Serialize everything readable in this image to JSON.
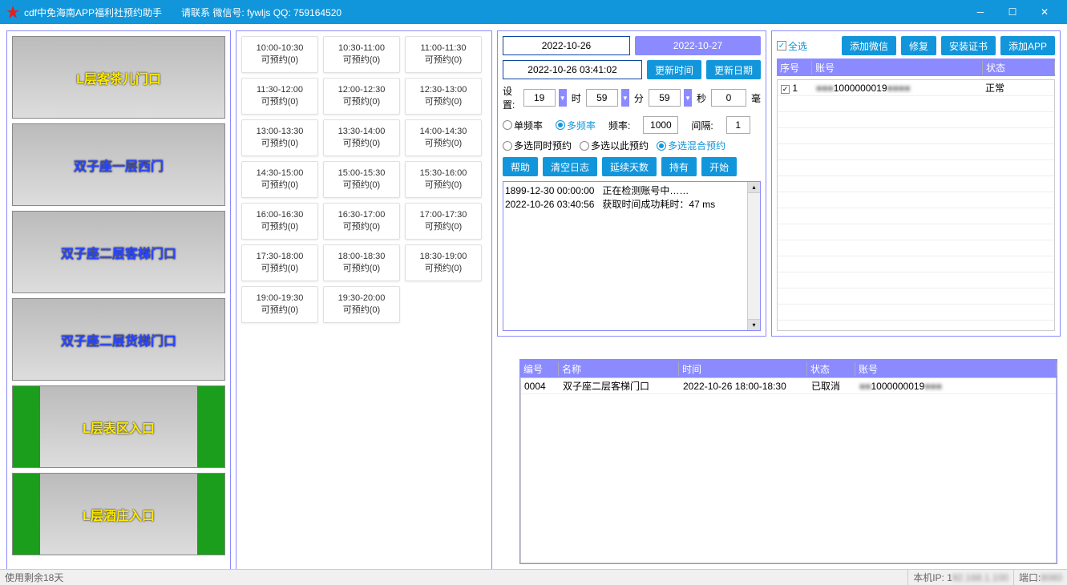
{
  "titlebar": {
    "app_title": "cdf中免海南APP福利社预约助手",
    "contact": "请联系   微信号: fywljs   QQ: 759164520"
  },
  "locations": [
    {
      "label": "L层客茶儿门口",
      "style": "yellow"
    },
    {
      "label": "双子座一层西门",
      "style": "blue"
    },
    {
      "label": "双子座二层客梯门口",
      "style": "blue"
    },
    {
      "label": "双子座二层货梯门口",
      "style": "blue"
    },
    {
      "label": "L层表区入口",
      "style": "yellow",
      "green": true
    },
    {
      "label": "L层酒庄入口",
      "style": "yellow",
      "green": true
    }
  ],
  "timeslots": [
    {
      "t": "10:00-10:30",
      "s": "可预约(0)"
    },
    {
      "t": "10:30-11:00",
      "s": "可预约(0)"
    },
    {
      "t": "11:00-11:30",
      "s": "可预约(0)"
    },
    {
      "t": "11:30-12:00",
      "s": "可预约(0)"
    },
    {
      "t": "12:00-12:30",
      "s": "可预约(0)"
    },
    {
      "t": "12:30-13:00",
      "s": "可预约(0)"
    },
    {
      "t": "13:00-13:30",
      "s": "可预约(0)"
    },
    {
      "t": "13:30-14:00",
      "s": "可预约(0)"
    },
    {
      "t": "14:00-14:30",
      "s": "可预约(0)"
    },
    {
      "t": "14:30-15:00",
      "s": "可预约(0)"
    },
    {
      "t": "15:00-15:30",
      "s": "可预约(0)"
    },
    {
      "t": "15:30-16:00",
      "s": "可预约(0)"
    },
    {
      "t": "16:00-16:30",
      "s": "可预约(0)"
    },
    {
      "t": "16:30-17:00",
      "s": "可预约(0)"
    },
    {
      "t": "17:00-17:30",
      "s": "可预约(0)"
    },
    {
      "t": "17:30-18:00",
      "s": "可预约(0)"
    },
    {
      "t": "18:00-18:30",
      "s": "可预约(0)"
    },
    {
      "t": "18:30-19:00",
      "s": "可预约(0)"
    },
    {
      "t": "19:00-19:30",
      "s": "可预约(0)"
    },
    {
      "t": "19:30-20:00",
      "s": "可预约(0)"
    }
  ],
  "control": {
    "date_current": "2022-10-26",
    "date_next": "2022-10-27",
    "datetime": "2022-10-26 03:41:02",
    "btn_update_time": "更新时间",
    "btn_update_date": "更新日期",
    "label_set": "设置:",
    "hour": "19",
    "label_hour": "时",
    "minute": "59",
    "label_minute": "分",
    "second": "59",
    "label_second": "秒",
    "ms": "0",
    "label_ms": "毫",
    "freq_single": "单频率",
    "freq_multi": "多频率",
    "label_freq": "频率:",
    "freq_val": "1000",
    "label_interval": "间隔:",
    "interval_val": "1",
    "mode_simul": "多选同时预约",
    "mode_seq": "多选以此预约",
    "mode_mix": "多选混合预约",
    "btn_help": "帮助",
    "btn_clear_log": "清空日志",
    "btn_ext_days": "延续天数",
    "btn_hold": "持有",
    "btn_start": "开始",
    "log": "1899-12-30 00:00:00   正在检测账号中……\n2022-10-26 03:40:56   获取时间成功耗时：47 ms\n"
  },
  "accounts": {
    "select_all": "全选",
    "btn_add_wechat": "添加微信",
    "btn_repair": "修复",
    "btn_install_cert": "安装证书",
    "btn_add_app": "添加APP",
    "headers": {
      "seq": "序号",
      "account": "账号",
      "status": "状态"
    },
    "rows": [
      {
        "checked": true,
        "seq": "1",
        "account": "1000000019",
        "status": "正常"
      }
    ]
  },
  "reservations": {
    "headers": {
      "id": "编号",
      "name": "名称",
      "time": "时间",
      "status": "状态",
      "account": "账号"
    },
    "rows": [
      {
        "id": "0004",
        "name": "双子座二层客梯门口",
        "time": "2022-10-26 18:00-18:30",
        "status": "已取消",
        "account": "1000000019"
      }
    ]
  },
  "statusbar": {
    "remaining": "使用剩余18天",
    "ip_label": "本机IP: 1",
    "port_label": "端口: "
  }
}
